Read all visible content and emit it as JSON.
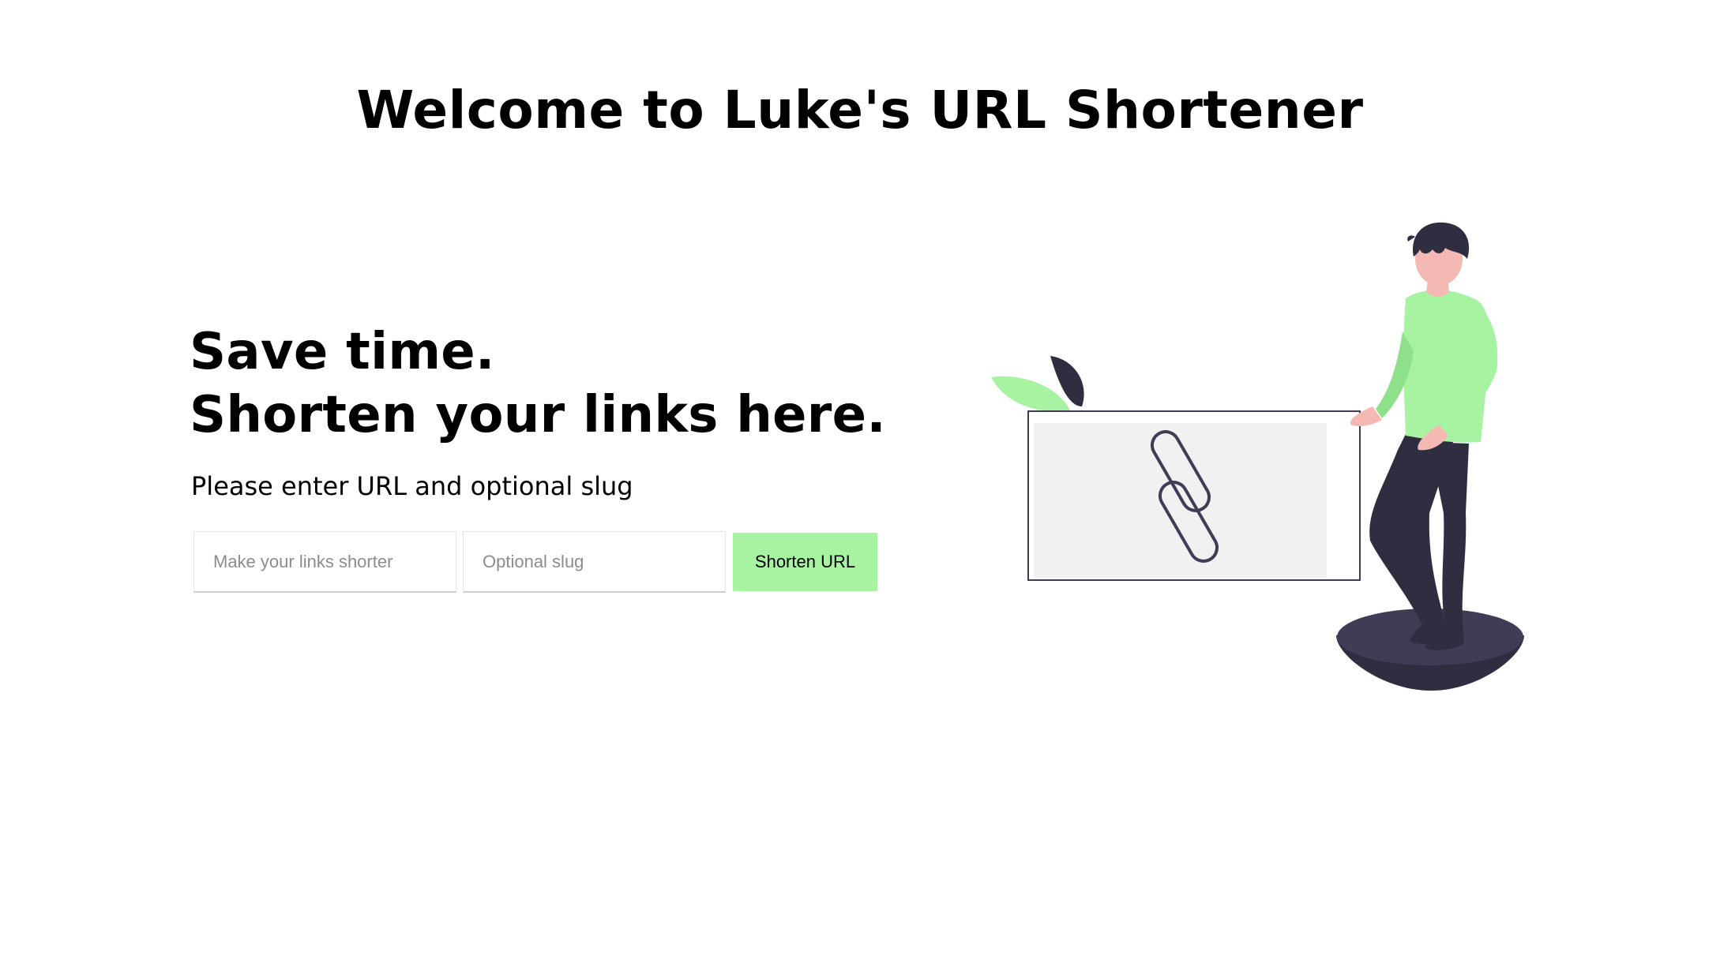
{
  "page": {
    "title": "Welcome to Luke's URL Shortener"
  },
  "hero": {
    "line1": "Save time.",
    "line2": "Shorten your links here.",
    "instruction": "Please enter URL and optional slug"
  },
  "form": {
    "url_placeholder": "Make your links shorter",
    "url_value": "",
    "slug_placeholder": "Optional slug",
    "slug_value": "",
    "submit_label": "Shorten URL"
  },
  "illustration": {
    "icon": "chain-link-icon",
    "figure": "person-standing",
    "colors": {
      "accent": "#a7f3a2",
      "dark": "#2f2e41",
      "skin": "#f5b9b3",
      "panel": "#f1f1f1"
    }
  }
}
